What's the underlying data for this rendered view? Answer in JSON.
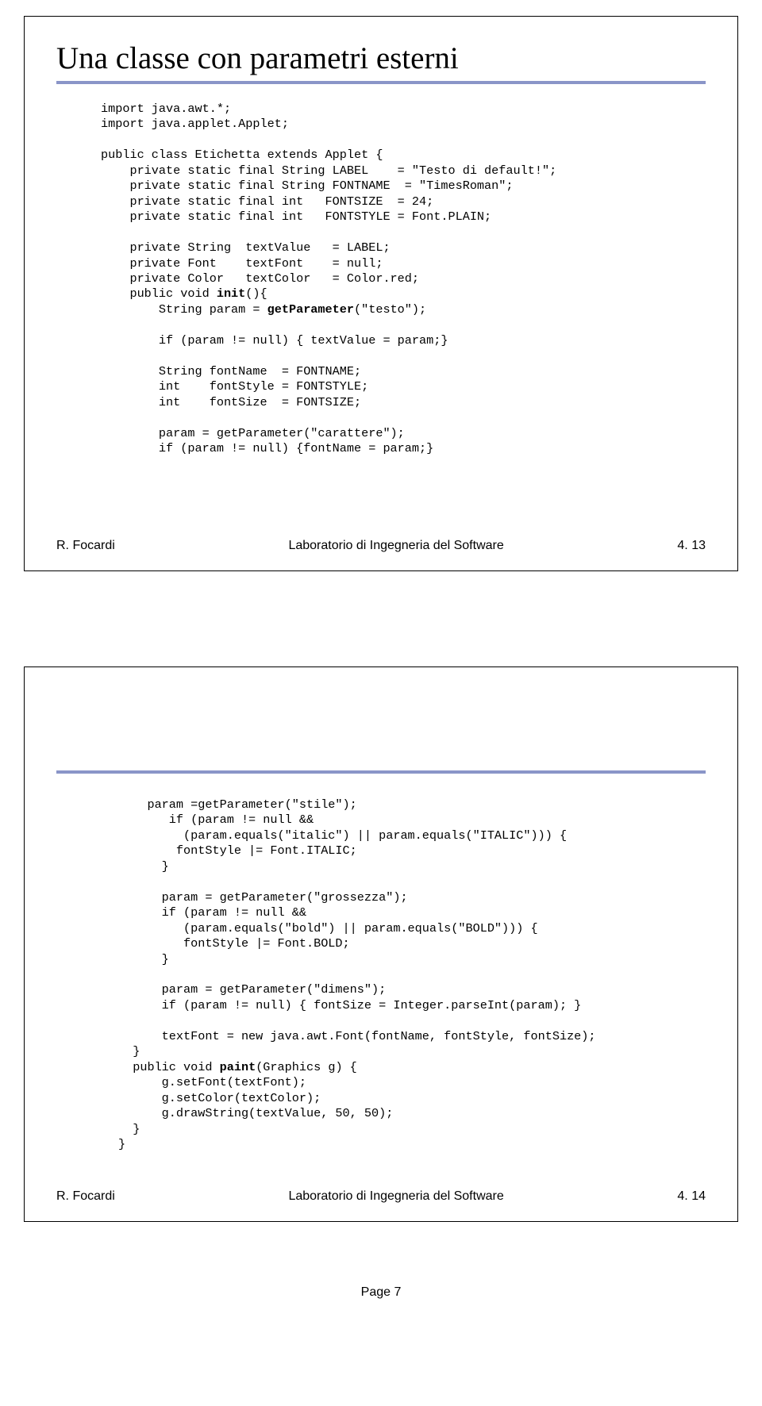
{
  "slide1": {
    "title": "Una classe con parametri esterni",
    "code1": "import java.awt.*;\nimport java.applet.Applet;\n\npublic class Etichetta extends Applet {\n    private static final String LABEL    = \"Testo di default!\";\n    private static final String FONTNAME  = \"TimesRoman\";\n    private static final int   FONTSIZE  = 24;\n    private static final int   FONTSTYLE = Font.PLAIN;\n\n    private String  textValue   = LABEL;\n    private Font    textFont    = null;\n    private Color   textColor   = Color.red;",
    "code2_a": "\n    public void ",
    "code2_bold1": "init",
    "code2_b": "(){\n        String param = ",
    "code2_bold2": "getParameter",
    "code2_c": "(\"testo\");\n\n        if (param != null) { textValue = param;}\n\n        String fontName  = FONTNAME;\n        int    fontStyle = FONTSTYLE;\n        int    fontSize  = FONTSIZE;\n\n        param = getParameter(\"carattere\");\n        if (param != null) {fontName = param;}",
    "footer_left": "R. Focardi",
    "footer_center": "Laboratorio di Ingegneria del Software",
    "footer_right": "4. 13"
  },
  "slide2": {
    "code1": "    param =getParameter(\"stile\");\n       if (param != null &&\n         (param.equals(\"italic\") || param.equals(\"ITALIC\"))) {\n        fontStyle |= Font.ITALIC;\n      }\n\n      param = getParameter(\"grossezza\");\n      if (param != null &&\n         (param.equals(\"bold\") || param.equals(\"BOLD\"))) {\n         fontStyle |= Font.BOLD;\n      }\n\n      param = getParameter(\"dimens\");\n      if (param != null) { fontSize = Integer.parseInt(param); }\n\n      textFont = new java.awt.Font(fontName, fontStyle, fontSize);\n  }",
    "code2_a": "\n  public void ",
    "code2_bold": "paint",
    "code2_b": "(Graphics g) {\n      g.setFont(textFont);\n      g.setColor(textColor);\n      g.drawString(textValue, 50, 50);\n  }\n}",
    "footer_left": "R. Focardi",
    "footer_center": "Laboratorio di Ingegneria del Software",
    "footer_right": "4. 14"
  },
  "page": "Page 7"
}
